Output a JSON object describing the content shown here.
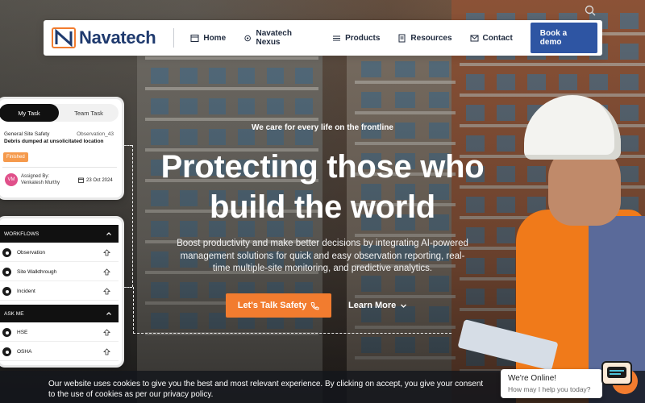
{
  "brand": {
    "name": "Navatech",
    "colors": {
      "primary": "#2e55a3",
      "accent": "#f27c2f",
      "dark": "#1f3a6e"
    }
  },
  "nav": {
    "items": [
      {
        "label": "Home",
        "icon": "home-icon"
      },
      {
        "label": "Navatech Nexus",
        "icon": "nexus-icon"
      },
      {
        "label": "Products",
        "icon": "menu-icon"
      },
      {
        "label": "Resources",
        "icon": "document-icon"
      },
      {
        "label": "Contact",
        "icon": "mail-icon"
      }
    ],
    "cta_label": "Book a demo"
  },
  "hero": {
    "tagline": "We care for every life on the frontline",
    "headline_line1": "Protecting those who",
    "headline_line2": "build the world",
    "subtext": "Boost productivity and make better decisions by integrating AI-powered management solutions for quick and easy observation reporting, real-time multiple-site monitoring, and predictive analytics.",
    "primary_cta": "Let's Talk Safety",
    "secondary_cta": "Learn More"
  },
  "task_card": {
    "tabs": [
      "My Task",
      "Team Task"
    ],
    "observation_title": "General Site Safety",
    "observation_id": "Observation_43",
    "observation_desc": "Debris dumped at unsolicitated location",
    "status": "Finished",
    "avatar_initials": "VM",
    "assigned_label": "Assigned By:",
    "assigned_name": "Venkatesh Murthy",
    "date": "23 Oct 2024"
  },
  "workflow_card": {
    "workflows_title": "WORKFLOWS",
    "workflows": [
      "Observation",
      "Site Walkthrough",
      "Incident"
    ],
    "askme_title": "ASK ME",
    "askme": [
      "HSE",
      "OSHA"
    ]
  },
  "cookie": {
    "text": "Our website uses cookies to give you the best and most relevant experience. By clicking on accept, you give your consent to the use of cookies as per our privacy policy."
  },
  "chat": {
    "title": "We're Online!",
    "subtitle": "How may I help you today?"
  }
}
